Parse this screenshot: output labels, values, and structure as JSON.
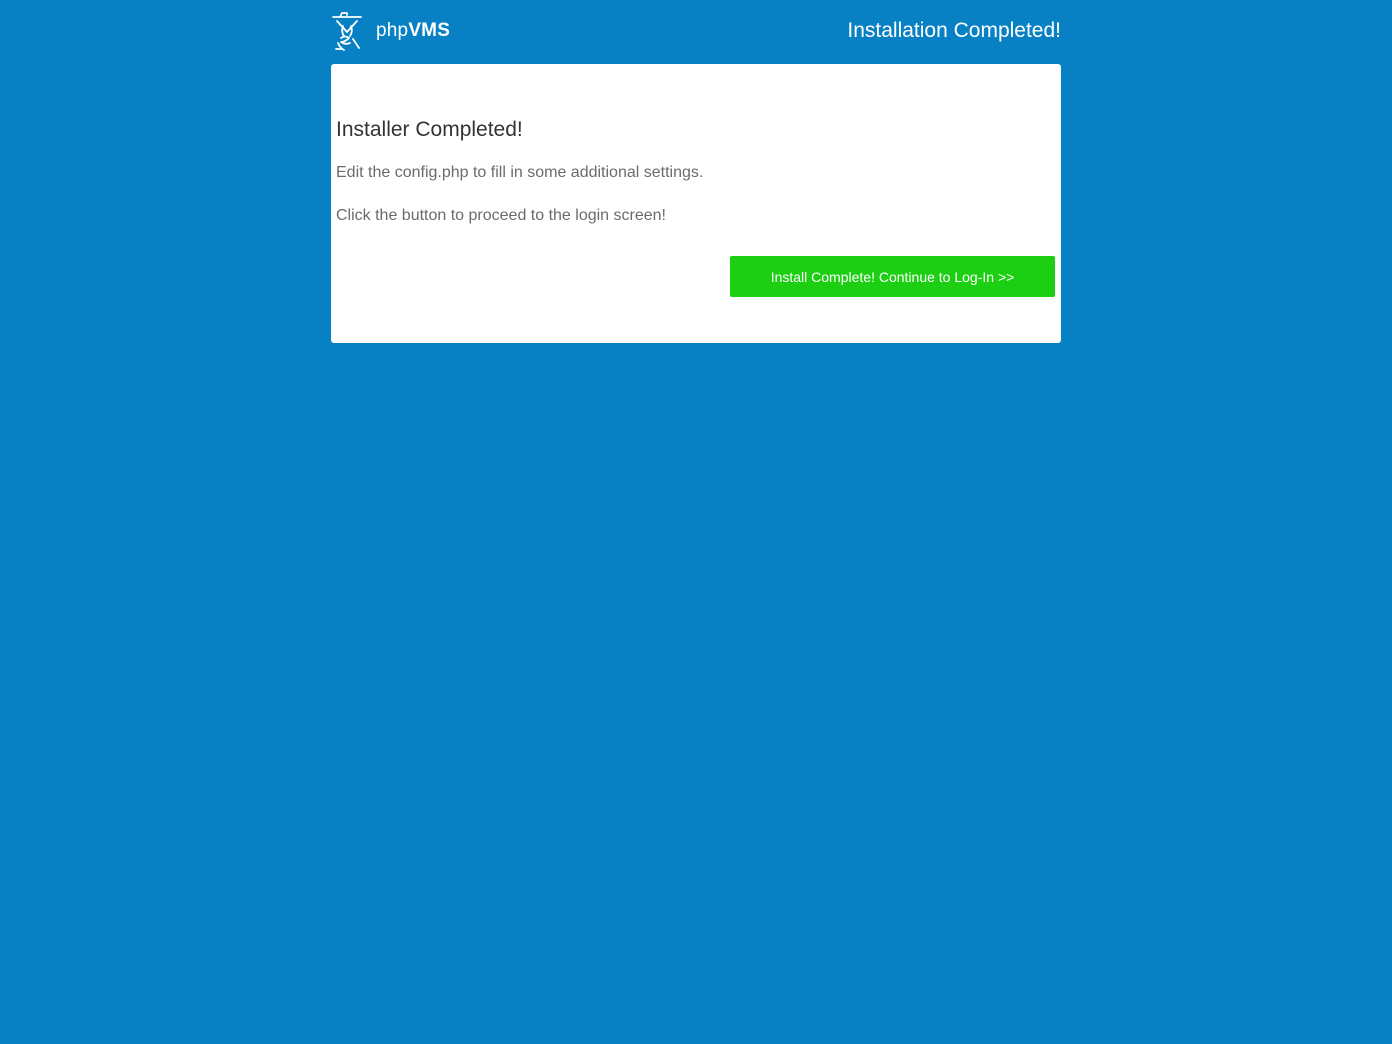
{
  "header": {
    "logo_icon": "phpvms-logo-icon",
    "brand_prefix": "php",
    "brand_suffix": "VMS",
    "page_title": "Installation Completed!"
  },
  "card": {
    "title": "Installer Completed!",
    "lines": [
      "Edit the config.php to fill in some additional settings.",
      "Click the button to proceed to the login screen!"
    ],
    "continue_button": "Install Complete! Continue to Log-In >>"
  },
  "colors": {
    "background": "#0880c4",
    "card": "#ffffff",
    "button": "#1ccf13",
    "title_text": "#333333",
    "body_text": "#6b6b6b"
  }
}
